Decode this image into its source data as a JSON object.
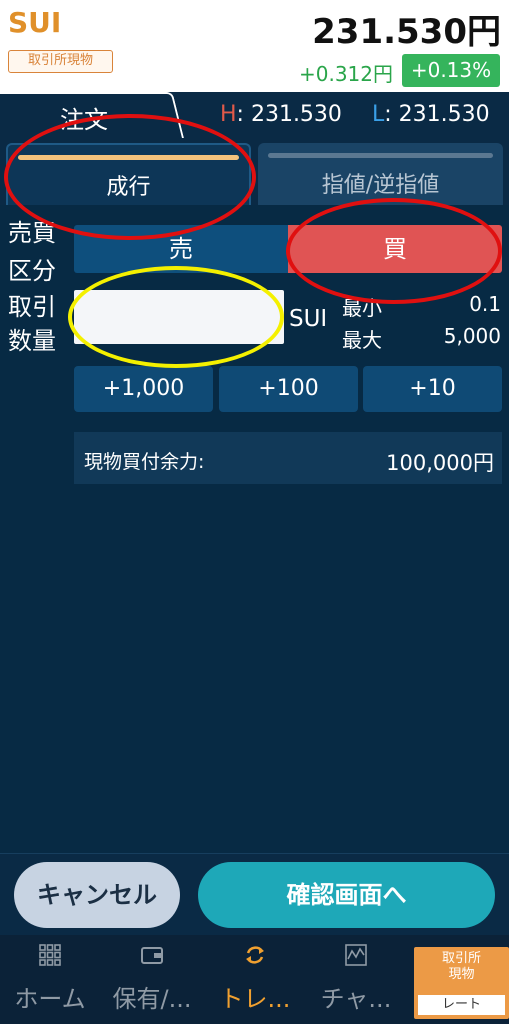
{
  "header": {
    "symbol": "SUI",
    "market_badge": "取引所現物",
    "price": "231.530円",
    "change": "+0.312円",
    "change_pct": "+0.13%"
  },
  "tabs": {
    "order_label": "注文",
    "high_key": "H",
    "high_value": ": 231.530",
    "low_key": "L",
    "low_value": ": 231.530"
  },
  "order_type": {
    "market_label": "成行",
    "limit_label": "指値/逆指値"
  },
  "form": {
    "side_label_line1": "売買",
    "side_label_line2": "区分",
    "sell_label": "売",
    "buy_label": "買",
    "qty_label_line1": "取引",
    "qty_label_line2": "数量",
    "qty_value": "",
    "qty_unit": "SUI",
    "min_label": "最小",
    "min_value": "0.1",
    "max_label": "最大",
    "max_value": "5,000",
    "step_buttons": [
      "+1,000",
      "+100",
      "+10"
    ],
    "balance_label": "現物買付余力:",
    "balance_value": "100,000円"
  },
  "actions": {
    "cancel_label": "キャンセル",
    "confirm_label": "確認画面へ"
  },
  "nav": {
    "items": [
      {
        "label": "ホーム",
        "icon": "grid-icon"
      },
      {
        "label": "保有/...",
        "icon": "wallet-icon"
      },
      {
        "label": "トレ...",
        "icon": "refresh-icon"
      },
      {
        "label": "チャ...",
        "icon": "chart-icon"
      }
    ],
    "rate_top": "取引所\n現物",
    "rate_bottom": "レート"
  },
  "colors": {
    "accent_orange": "#e0902a",
    "buy_red": "#e05454",
    "up_green": "#35b45c",
    "confirm_teal": "#1ea8b8",
    "annotation_red": "#e01010",
    "annotation_yellow": "#f4f000"
  }
}
